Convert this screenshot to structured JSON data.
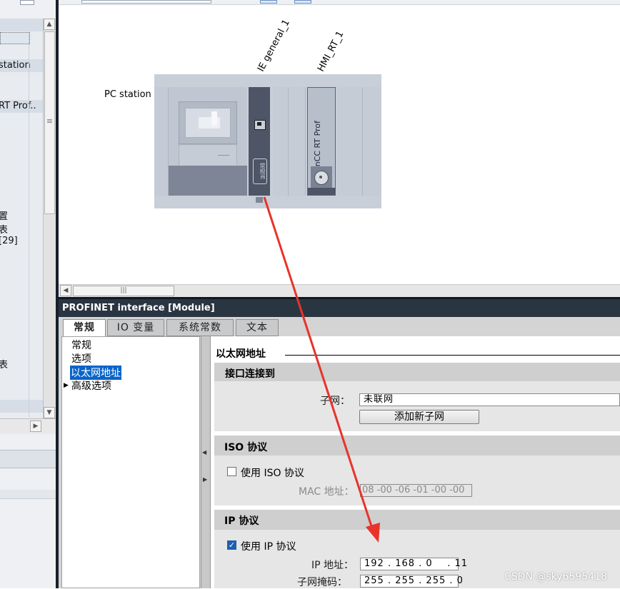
{
  "project_tree": {
    "rows": [
      "station",
      "RT Prof..",
      "置",
      "表",
      "[29]",
      "表"
    ],
    "scroll_thumb_symbol": "≡"
  },
  "device_view": {
    "station_label": "PC station",
    "modules": [
      {
        "name": "IE general_1"
      },
      {
        "name": "HMI_RT_1"
      }
    ],
    "wincc_slot_text": "WinCC RT Prof",
    "ie_slot_text": "常规IE",
    "hscroll_thumb_symbol": "|||"
  },
  "properties": {
    "title": "PROFINET interface [Module]",
    "tabs": [
      {
        "label": "常规",
        "active": true
      },
      {
        "label": "IO 变量",
        "active": false
      },
      {
        "label": "系统常数",
        "active": false
      },
      {
        "label": "文本",
        "active": false
      }
    ],
    "nav": [
      {
        "label": "常规",
        "selected": false
      },
      {
        "label": "选项",
        "selected": false
      },
      {
        "label": "以太网地址",
        "selected": true
      },
      {
        "label": "高级选项",
        "selected": false
      }
    ],
    "ethernet_title": "以太网地址",
    "interface_section": {
      "title": "接口连接到",
      "subnet_label": "子网：",
      "subnet_value": "未联网",
      "add_subnet_button": "添加新子网"
    },
    "iso_section": {
      "title": "ISO 协议",
      "use_iso_label": "使用 ISO 协议",
      "use_iso_checked": false,
      "mac_label": "MAC 地址：",
      "mac_value": "08 -00 -06 -01 -00 -00"
    },
    "ip_section": {
      "title": "IP 协议",
      "use_ip_label": "使用 IP 协议",
      "use_ip_checked": true,
      "ip_label": "IP 地址：",
      "ip_value": "192 . 168 . 0    . 11",
      "mask_label": "子网掩码：",
      "mask_value": "255 . 255 . 255 . 0"
    }
  },
  "colors": {
    "header_bg": "#2a3542",
    "selection": "#0a64c8",
    "annotation_arrow": "#e8332a"
  },
  "watermark": "CSDN @sky6595418"
}
